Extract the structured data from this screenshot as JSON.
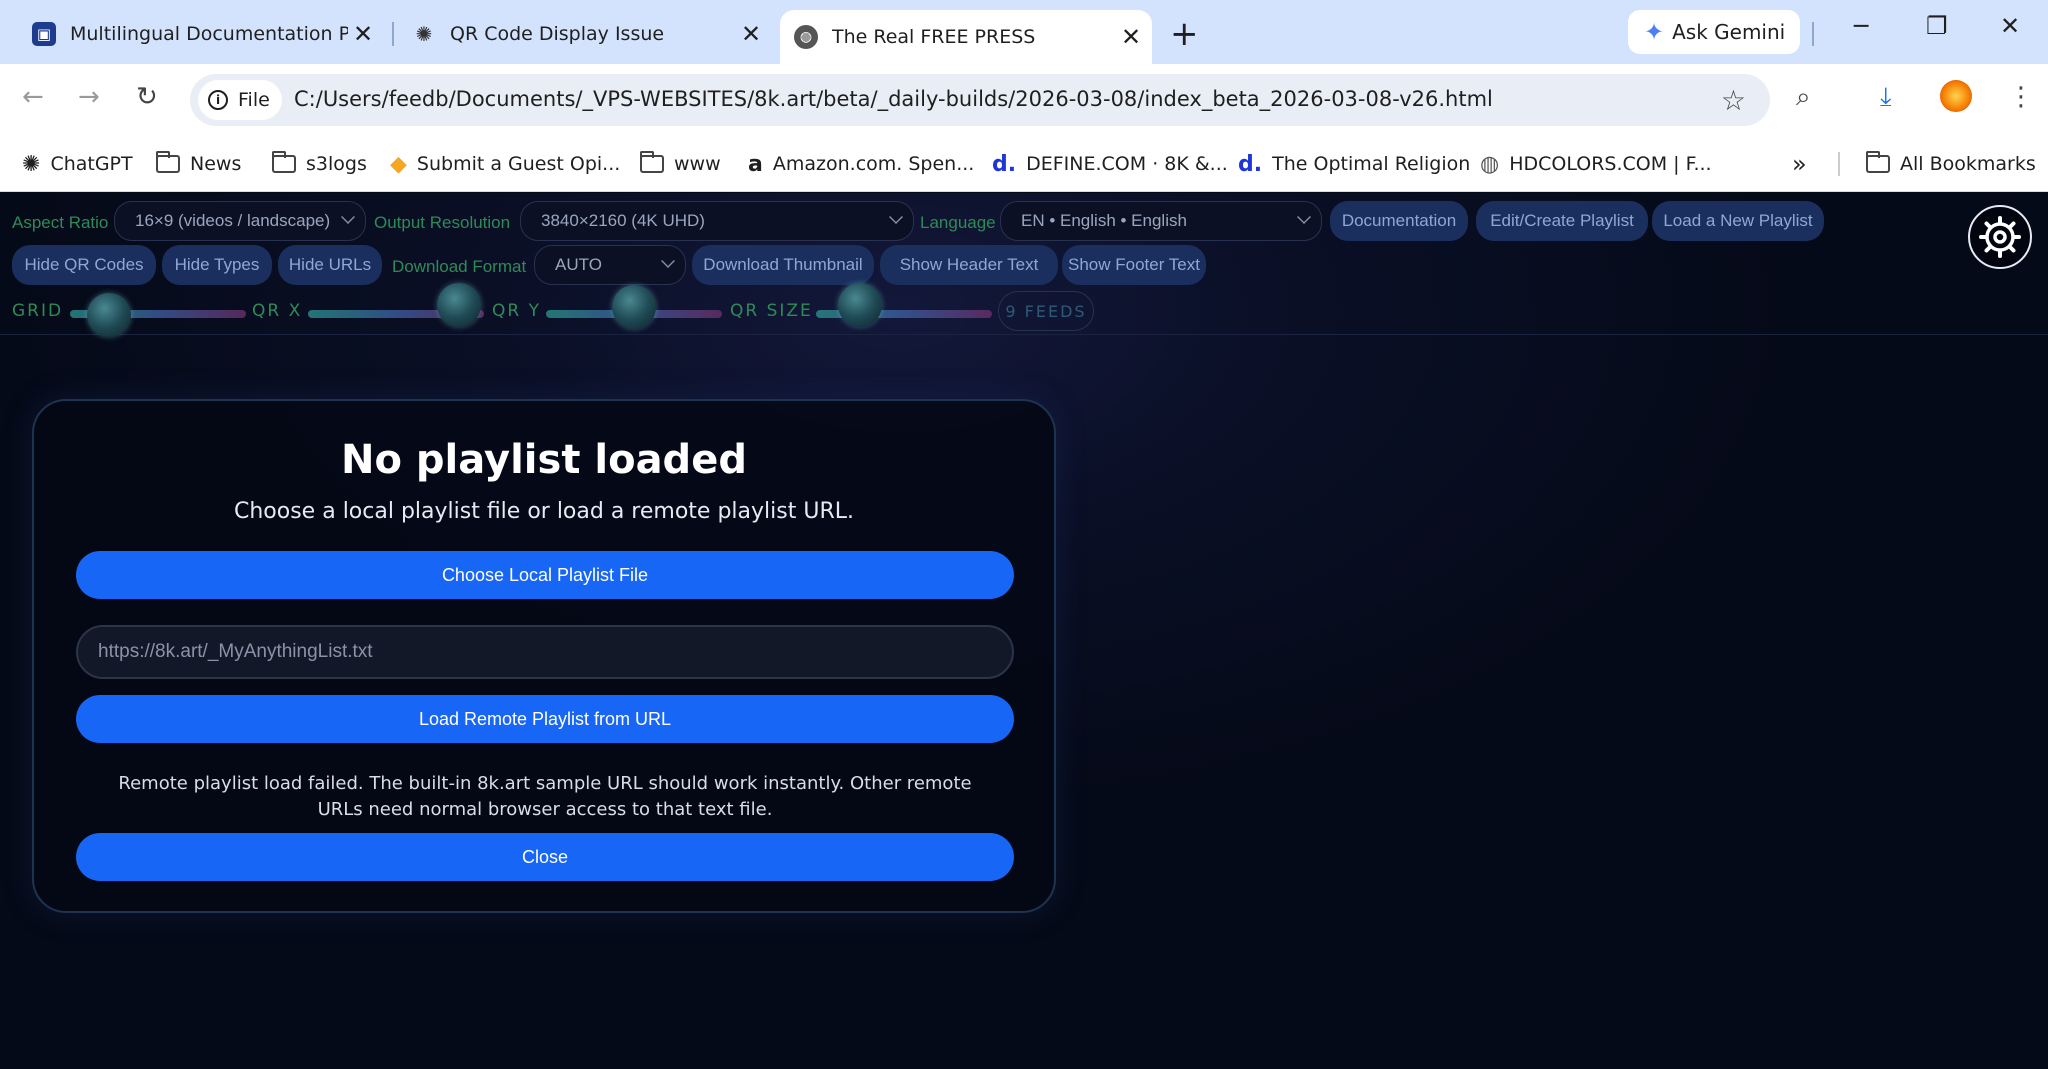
{
  "browser": {
    "tabs": [
      {
        "title": "Multilingual Documentation Po",
        "icon": "app-icon"
      },
      {
        "title": "QR Code Display Issue",
        "icon": "openai-icon"
      },
      {
        "title": "The Real FREE PRESS",
        "icon": "globe-icon"
      }
    ],
    "ask_gemini": "Ask Gemini",
    "address": {
      "chip": "File",
      "url": "C:/Users/feedb/Documents/_VPS-WEBSITES/8k.art/beta/_daily-builds/2026-03-08/index_beta_2026-03-08-v26.html"
    },
    "bookmarks": [
      {
        "label": "ChatGPT",
        "icon": "openai-icon"
      },
      {
        "label": "News",
        "icon": "folder-icon"
      },
      {
        "label": "s3logs",
        "icon": "folder-icon"
      },
      {
        "label": "Submit a Guest Opi...",
        "icon": "airtable-icon"
      },
      {
        "label": "www",
        "icon": "folder-icon"
      },
      {
        "label": "Amazon.com. Spen...",
        "icon": "amazon-icon"
      },
      {
        "label": "DEFINE.COM · 8K &...",
        "icon": "define-icon"
      },
      {
        "label": "The Optimal Religion",
        "icon": "define-icon"
      },
      {
        "label": "HDCOLORS.COM | F...",
        "icon": "globe-icon"
      }
    ],
    "all_bookmarks": "All Bookmarks"
  },
  "controls": {
    "aspect_label": "Aspect Ratio",
    "aspect_value": "16×9 (videos / landscape)",
    "resolution_label": "Output Resolution",
    "resolution_value": "3840×2160 (4K UHD)",
    "language_label": "Language",
    "language_value": "EN • English • English",
    "documentation": "Documentation",
    "edit_playlist": "Edit/Create Playlist",
    "load_playlist": "Load a New Playlist",
    "hide_qr": "Hide QR Codes",
    "hide_types": "Hide Types",
    "hide_urls": "Hide URLs",
    "download_format_label": "Download Format",
    "download_format_value": "AUTO",
    "download_thumbnail": "Download Thumbnail",
    "show_header": "Show Header Text",
    "show_footer": "Show Footer Text",
    "sliders": {
      "grid": {
        "label": "GRID",
        "value": 0.22
      },
      "qr_x": {
        "label": "QR X",
        "value": 0.86
      },
      "qr_y": {
        "label": "QR Y",
        "value": 0.5
      },
      "qr_size": {
        "label": "QR SIZE",
        "value": 0.25
      }
    },
    "feeds": "9 FEEDS"
  },
  "dialog": {
    "title": "No playlist loaded",
    "subtitle": "Choose a local playlist file or load a remote playlist URL.",
    "choose_local": "Choose Local Playlist File",
    "url_placeholder": "https://8k.art/_MyAnythingList.txt",
    "load_remote": "Load Remote Playlist from URL",
    "message": "Remote playlist load failed. The built-in 8k.art sample URL should work instantly. Other remote URLs need normal browser access to that text file.",
    "close": "Close"
  },
  "colors": {
    "accent": "#1766f5",
    "label_green": "#2e8b57",
    "pill_bg": "#1a2f5e",
    "page_bg": "#050a18"
  }
}
